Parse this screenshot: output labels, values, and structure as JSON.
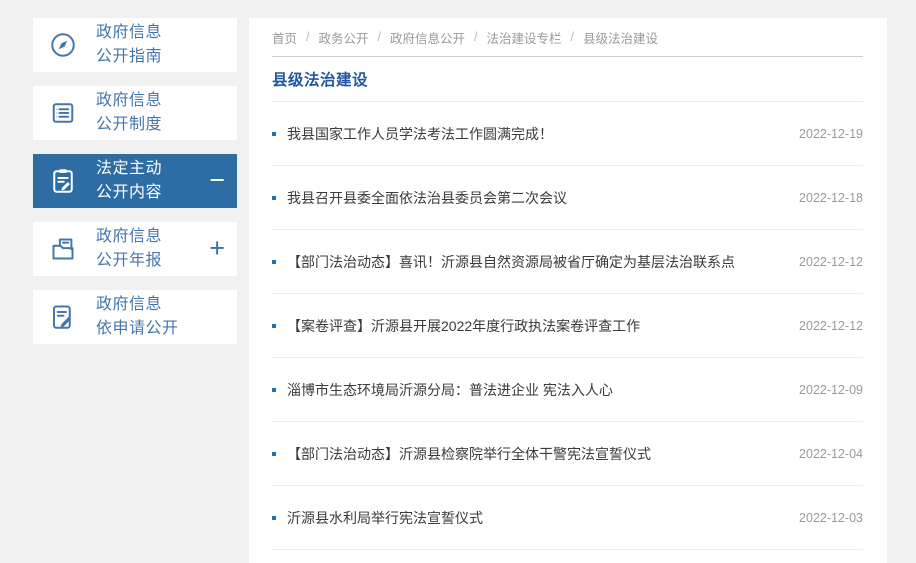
{
  "page": {
    "bg_color": "#f1f1f1",
    "accent_color": "#2e6da4",
    "title_color": "#2256a4"
  },
  "sidebar": {
    "items": [
      {
        "icon": "compass-icon",
        "line1": "政府信息",
        "line2": "公开指南",
        "active": false,
        "toggle": ""
      },
      {
        "icon": "list-document-icon",
        "line1": "政府信息",
        "line2": "公开制度",
        "active": false,
        "toggle": ""
      },
      {
        "icon": "clipboard-edit-icon",
        "line1": "法定主动",
        "line2": "公开内容",
        "active": true,
        "toggle": "−"
      },
      {
        "icon": "folder-document-icon",
        "line1": "政府信息",
        "line2": "公开年报",
        "active": false,
        "toggle": "+"
      },
      {
        "icon": "document-pen-icon",
        "line1": "政府信息",
        "line2": "依申请公开",
        "active": false,
        "toggle": ""
      }
    ]
  },
  "breadcrumb": {
    "separator": "/",
    "items": [
      "首页",
      "政务公开",
      "政府信息公开",
      "法治建设专栏",
      "县级法治建设"
    ]
  },
  "main": {
    "section_title": "县级法治建设",
    "news": [
      {
        "title": "我县国家工作人员学法考法工作圆满完成！",
        "date": "2022-12-19"
      },
      {
        "title": "我县召开县委全面依法治县委员会第二次会议",
        "date": "2022-12-18"
      },
      {
        "title": "【部门法治动态】喜讯！沂源县自然资源局被省厅确定为基层法治联系点",
        "date": "2022-12-12"
      },
      {
        "title": "【案卷评查】沂源县开展2022年度行政执法案卷评查工作",
        "date": "2022-12-12"
      },
      {
        "title": "淄博市生态环境局沂源分局：普法进企业 宪法入人心",
        "date": "2022-12-09"
      },
      {
        "title": "【部门法治动态】沂源县检察院举行全体干警宪法宣誓仪式",
        "date": "2022-12-04"
      },
      {
        "title": "沂源县水利局举行宪法宣誓仪式",
        "date": "2022-12-03"
      }
    ]
  }
}
